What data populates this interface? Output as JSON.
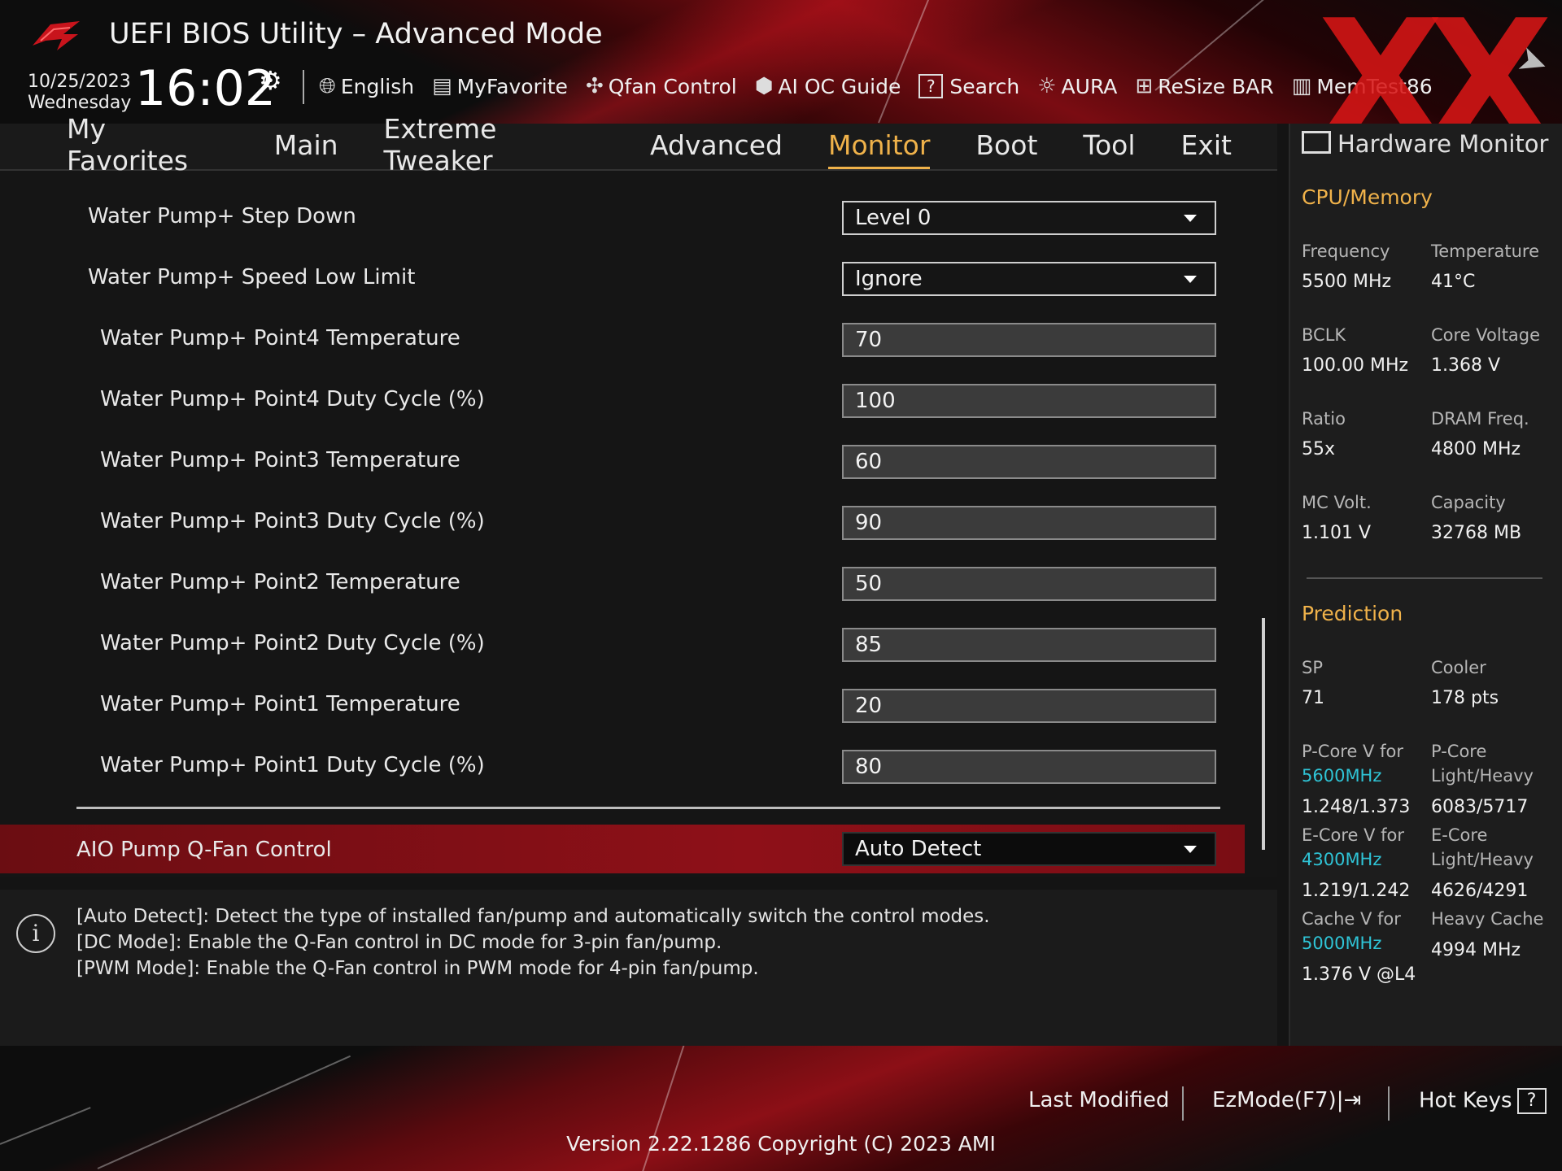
{
  "header": {
    "title": "UEFI BIOS Utility – Advanced Mode",
    "date": "10/25/2023",
    "weekday": "Wednesday",
    "time": "16:02",
    "toolbar": [
      {
        "name": "language",
        "label": "English",
        "icon": "globe-icon"
      },
      {
        "name": "myfavorite",
        "label": "MyFavorite",
        "icon": "favorite-list-icon"
      },
      {
        "name": "qfan-control",
        "label": "Qfan Control",
        "icon": "fan-icon"
      },
      {
        "name": "ai-oc-guide",
        "label": "AI OC Guide",
        "icon": "chip-icon"
      },
      {
        "name": "search",
        "label": "Search",
        "icon": "question-box-icon"
      },
      {
        "name": "aura",
        "label": "AURA",
        "icon": "light-icon"
      },
      {
        "name": "resize-bar",
        "label": "ReSize BAR",
        "icon": "resize-bar-icon"
      },
      {
        "name": "memtest",
        "label": "MemTest86",
        "icon": "memory-icon"
      }
    ]
  },
  "menu": {
    "tabs": [
      "My Favorites",
      "Main",
      "Extreme Tweaker",
      "Advanced",
      "Monitor",
      "Boot",
      "Tool",
      "Exit"
    ],
    "active": "Monitor"
  },
  "settings": [
    {
      "label": "Water Pump+ Step Down",
      "value": "Level 0",
      "type": "dropdown",
      "indent": 1
    },
    {
      "label": "Water Pump+ Speed Low Limit",
      "value": "Ignore",
      "type": "dropdown",
      "indent": 1
    },
    {
      "label": "Water Pump+ Point4 Temperature",
      "value": "70",
      "type": "input",
      "indent": 2
    },
    {
      "label": "Water Pump+ Point4 Duty Cycle (%)",
      "value": "100",
      "type": "input",
      "indent": 2
    },
    {
      "label": "Water Pump+ Point3 Temperature",
      "value": "60",
      "type": "input",
      "indent": 2
    },
    {
      "label": "Water Pump+ Point3 Duty Cycle (%)",
      "value": "90",
      "type": "input",
      "indent": 2
    },
    {
      "label": "Water Pump+ Point2 Temperature",
      "value": "50",
      "type": "input",
      "indent": 2
    },
    {
      "label": "Water Pump+ Point2 Duty Cycle (%)",
      "value": "85",
      "type": "input",
      "indent": 2
    },
    {
      "label": "Water Pump+ Point1 Temperature",
      "value": "20",
      "type": "input",
      "indent": 2
    },
    {
      "label": "Water Pump+ Point1 Duty Cycle (%)",
      "value": "80",
      "type": "input",
      "indent": 2
    }
  ],
  "selected_setting": {
    "label": "AIO Pump Q-Fan Control",
    "value": "Auto Detect"
  },
  "help": [
    "[Auto Detect]: Detect the type of installed fan/pump and automatically switch the control modes.",
    "[DC Mode]: Enable the Q-Fan control in DC mode for 3-pin fan/pump.",
    "[PWM Mode]: Enable the Q-Fan control in PWM mode for 4-pin fan/pump."
  ],
  "hw_monitor": {
    "title": "Hardware Monitor",
    "cpu_section": "CPU/Memory",
    "cpu": [
      {
        "k": "Frequency",
        "v": "5500 MHz"
      },
      {
        "k": "Temperature",
        "v": "41°C"
      },
      {
        "k": "BCLK",
        "v": "100.00 MHz"
      },
      {
        "k": "Core Voltage",
        "v": "1.368 V"
      },
      {
        "k": "Ratio",
        "v": "55x"
      },
      {
        "k": "DRAM Freq.",
        "v": "4800 MHz"
      },
      {
        "k": "MC Volt.",
        "v": "1.101 V"
      },
      {
        "k": "Capacity",
        "v": "32768 MB"
      }
    ],
    "prediction_section": "Prediction",
    "sp": {
      "k": "SP",
      "v": "71"
    },
    "cooler": {
      "k": "Cooler",
      "v": "178 pts"
    },
    "pcore_v": {
      "k": "P-Core V for",
      "freq": "5600MHz",
      "v": "1.248/1.373"
    },
    "pcore_lh": {
      "k1": "P-Core",
      "k2": "Light/Heavy",
      "v": "6083/5717"
    },
    "ecore_v": {
      "k": "E-Core V for",
      "freq": "4300MHz",
      "v": "1.219/1.242"
    },
    "ecore_lh": {
      "k1": "E-Core",
      "k2": "Light/Heavy",
      "v": "4626/4291"
    },
    "cache_v": {
      "k": "Cache V for",
      "freq": "5000MHz",
      "v": "1.376 V @L4"
    },
    "heavy_cache": {
      "k": "Heavy Cache",
      "v": "4994 MHz"
    }
  },
  "footer": {
    "last_modified": "Last Modified",
    "ezmode": "EzMode(F7)",
    "hotkeys": "Hot Keys",
    "version": "Version 2.22.1286 Copyright (C) 2023 AMI"
  },
  "colors": {
    "accent": "#f0b24a",
    "highlight_row": "#8e1018",
    "cyan": "#2fc4d6"
  }
}
